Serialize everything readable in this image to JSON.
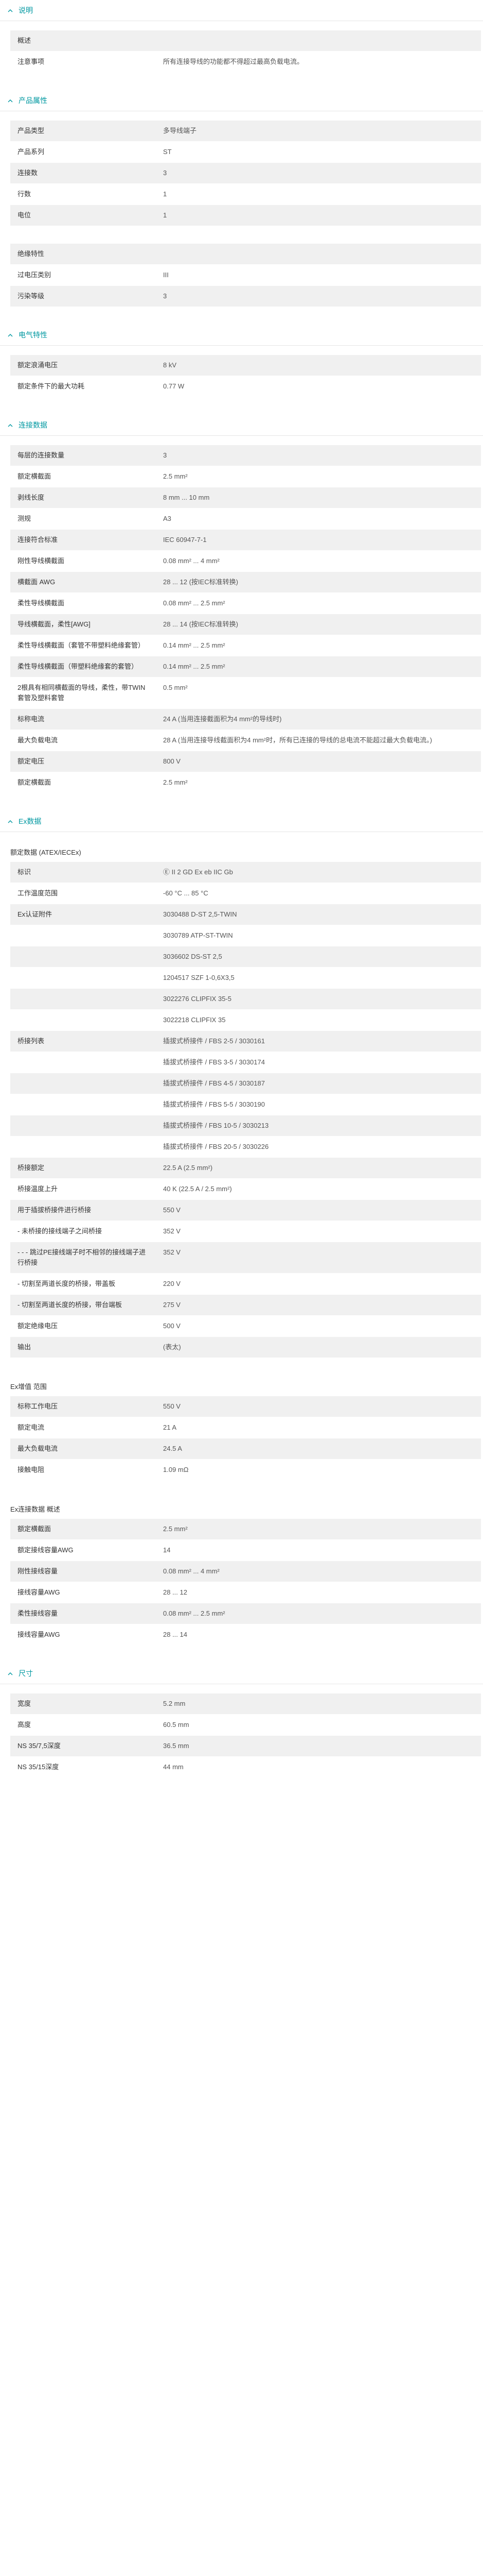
{
  "sections": [
    {
      "title": "说明",
      "groups": [
        {
          "subtitle": "",
          "rows": [
            {
              "k": "概述",
              "v": ""
            },
            {
              "k": "注意事项",
              "v": "所有连接导线的功能都不得超过最高负载电流。"
            }
          ]
        }
      ]
    },
    {
      "title": "产品属性",
      "groups": [
        {
          "subtitle": "",
          "rows": [
            {
              "k": "产品类型",
              "v": "多导线端子"
            },
            {
              "k": "产品系列",
              "v": "ST"
            },
            {
              "k": "连接数",
              "v": "3"
            },
            {
              "k": "行数",
              "v": "1"
            },
            {
              "k": "电位",
              "v": "1"
            }
          ]
        },
        {
          "subtitle": "",
          "rows": [
            {
              "k": "绝缘特性",
              "v": ""
            },
            {
              "k": "过电压类别",
              "v": "III"
            },
            {
              "k": "污染等级",
              "v": "3"
            }
          ]
        }
      ]
    },
    {
      "title": "电气特性",
      "groups": [
        {
          "subtitle": "",
          "rows": [
            {
              "k": "额定浪涌电压",
              "v": "8 kV"
            },
            {
              "k": "额定条件下的最大功耗",
              "v": "0.77 W"
            }
          ]
        }
      ]
    },
    {
      "title": "连接数据",
      "groups": [
        {
          "subtitle": "",
          "rows": [
            {
              "k": "每层的连接数量",
              "v": "3"
            },
            {
              "k": "额定横截面",
              "v": "2.5 mm²"
            },
            {
              "k": "剥线长度",
              "v": "8 mm ... 10 mm"
            },
            {
              "k": "测规",
              "v": "A3"
            },
            {
              "k": "连接符合标准",
              "v": "IEC 60947-7-1"
            },
            {
              "k": "刚性导线横截面",
              "v": "0.08 mm² ... 4 mm²"
            },
            {
              "k": "横截面 AWG",
              "v": "28 ... 12 (按IEC标准转换)"
            },
            {
              "k": "柔性导线横截面",
              "v": "0.08 mm² ... 2.5 mm²"
            },
            {
              "k": "导线横截面，柔性[AWG]",
              "v": "28 ... 14 (按IEC标准转换)"
            },
            {
              "k": "柔性导线横截面（套管不带塑料绝缘套管）",
              "v": "0.14 mm² ... 2.5 mm²"
            },
            {
              "k": "柔性导线横截面（带塑料绝缘套的套管）",
              "v": "0.14 mm² ... 2.5 mm²"
            },
            {
              "k": "2根具有相同横截面的导线，柔性，带TWIN套管及塑料套管",
              "v": "0.5 mm²"
            },
            {
              "k": "标称电流",
              "v": "24 A (当用连接截面积为4 mm²的导线时)"
            },
            {
              "k": "最大负载电流",
              "v": "28 A (当用连接导线截面积为4 mm²时，所有已连接的导线的总电流不能超过最大负载电流。)"
            },
            {
              "k": "额定电压",
              "v": "800 V"
            },
            {
              "k": "额定横截面",
              "v": "2.5 mm²"
            }
          ]
        }
      ]
    },
    {
      "title": "Ex数据",
      "groups": [
        {
          "subtitle": "额定数据 (ATEX/IECEx)",
          "rows": [
            {
              "k": "标识",
              "v": "Ⓔ II 2 GD Ex eb IIC Gb"
            },
            {
              "k": "工作温度范围",
              "v": "-60 °C ... 85 °C"
            },
            {
              "k": "Ex认证附件",
              "v": "3030488 D-ST 2,5-TWIN"
            },
            {
              "k": "",
              "v": "3030789 ATP-ST-TWIN"
            },
            {
              "k": "",
              "v": "3036602 DS-ST 2,5"
            },
            {
              "k": "",
              "v": "1204517 SZF 1-0,6X3,5"
            },
            {
              "k": "",
              "v": "3022276 CLIPFIX 35-5"
            },
            {
              "k": "",
              "v": "3022218 CLIPFIX 35"
            },
            {
              "k": "桥接列表",
              "v": "插拔式桥接件 / FBS 2-5 / 3030161"
            },
            {
              "k": "",
              "v": "插拔式桥接件 / FBS 3-5 / 3030174"
            },
            {
              "k": "",
              "v": "插拔式桥接件 / FBS 4-5 / 3030187"
            },
            {
              "k": "",
              "v": "插拔式桥接件 / FBS 5-5 / 3030190"
            },
            {
              "k": "",
              "v": "插拔式桥接件 / FBS 10-5 / 3030213"
            },
            {
              "k": "",
              "v": "插拔式桥接件 / FBS 20-5 / 3030226"
            },
            {
              "k": "桥接额定",
              "v": "22.5 A (2.5 mm²)"
            },
            {
              "k": "桥接温度上升",
              "v": "40 K (22.5 A / 2.5 mm²)"
            },
            {
              "k": "用于插拔桥接件进行桥接",
              "v": "550 V"
            },
            {
              "k": "- 未桥接的接线端子之间桥接",
              "v": "352 V"
            },
            {
              "k": "- - - 跳过PE接线端子时不相邻的接线端子进行桥接",
              "v": "352 V"
            },
            {
              "k": "- 切割至两道长度的桥接，带盖板",
              "v": "220 V"
            },
            {
              "k": "- 切割至两道长度的桥接，带台端板",
              "v": "275 V"
            },
            {
              "k": "额定绝缘电压",
              "v": "500 V"
            },
            {
              "k": "输出",
              "v": "(表太)"
            }
          ]
        },
        {
          "subtitle": "Ex增值 范围",
          "rows": [
            {
              "k": "标称工作电压",
              "v": "550 V"
            },
            {
              "k": "额定电流",
              "v": "21 A"
            },
            {
              "k": "最大负载电流",
              "v": "24.5 A"
            },
            {
              "k": "接触电阻",
              "v": "1.09 mΩ"
            }
          ]
        },
        {
          "subtitle": "Ex连接数据 概述",
          "rows": [
            {
              "k": "额定横截面",
              "v": "2.5 mm²"
            },
            {
              "k": "额定接线容量AWG",
              "v": "14"
            },
            {
              "k": "刚性接线容量",
              "v": "0.08 mm² ... 4 mm²"
            },
            {
              "k": "接线容量AWG",
              "v": "28 ... 12"
            },
            {
              "k": "柔性接线容量",
              "v": "0.08 mm² ... 2.5 mm²"
            },
            {
              "k": "接线容量AWG",
              "v": "28 ... 14"
            }
          ]
        }
      ]
    },
    {
      "title": "尺寸",
      "groups": [
        {
          "subtitle": "",
          "rows": [
            {
              "k": "宽度",
              "v": "5.2 mm"
            },
            {
              "k": "高度",
              "v": "60.5 mm"
            },
            {
              "k": "NS 35/7,5深度",
              "v": "36.5 mm"
            },
            {
              "k": "NS 35/15深度",
              "v": "44 mm"
            }
          ]
        }
      ]
    }
  ],
  "icons": {
    "section_toggle": "chevron-up-icon"
  },
  "colors": {
    "accent": "#0098a1",
    "row_alt": "#f0f0f0"
  }
}
